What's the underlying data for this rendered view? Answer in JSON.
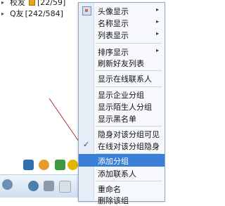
{
  "buddy_list": {
    "groups": [
      {
        "name": "校友",
        "count": "[22/59]"
      },
      {
        "name": "Q友",
        "count": "[242/584]"
      }
    ]
  },
  "context_menu": {
    "items": [
      {
        "label": "头像显示",
        "has_submenu": true
      },
      {
        "label": "名称显示",
        "has_submenu": true
      },
      {
        "label": "列表显示",
        "has_submenu": true
      },
      {
        "label": "排序显示",
        "has_submenu": true
      },
      {
        "label": "刷新好友列表"
      },
      {
        "label": "显示在线联系人"
      },
      {
        "label": "显示企业分组"
      },
      {
        "label": "显示陌生人分组"
      },
      {
        "label": "显示黑名单"
      },
      {
        "label": "隐身对该分组可见"
      },
      {
        "label": "在线对该分组隐身",
        "checked": true
      },
      {
        "label": "添加分组",
        "highlighted": true
      },
      {
        "label": "添加联系人"
      },
      {
        "label": "重命名"
      },
      {
        "label": "删除该组"
      }
    ],
    "submenu_arrow": "▸",
    "check_mark": "✓",
    "highlight_color": "#3c7fd6"
  },
  "icons": {
    "expand_arrow": "▸"
  }
}
